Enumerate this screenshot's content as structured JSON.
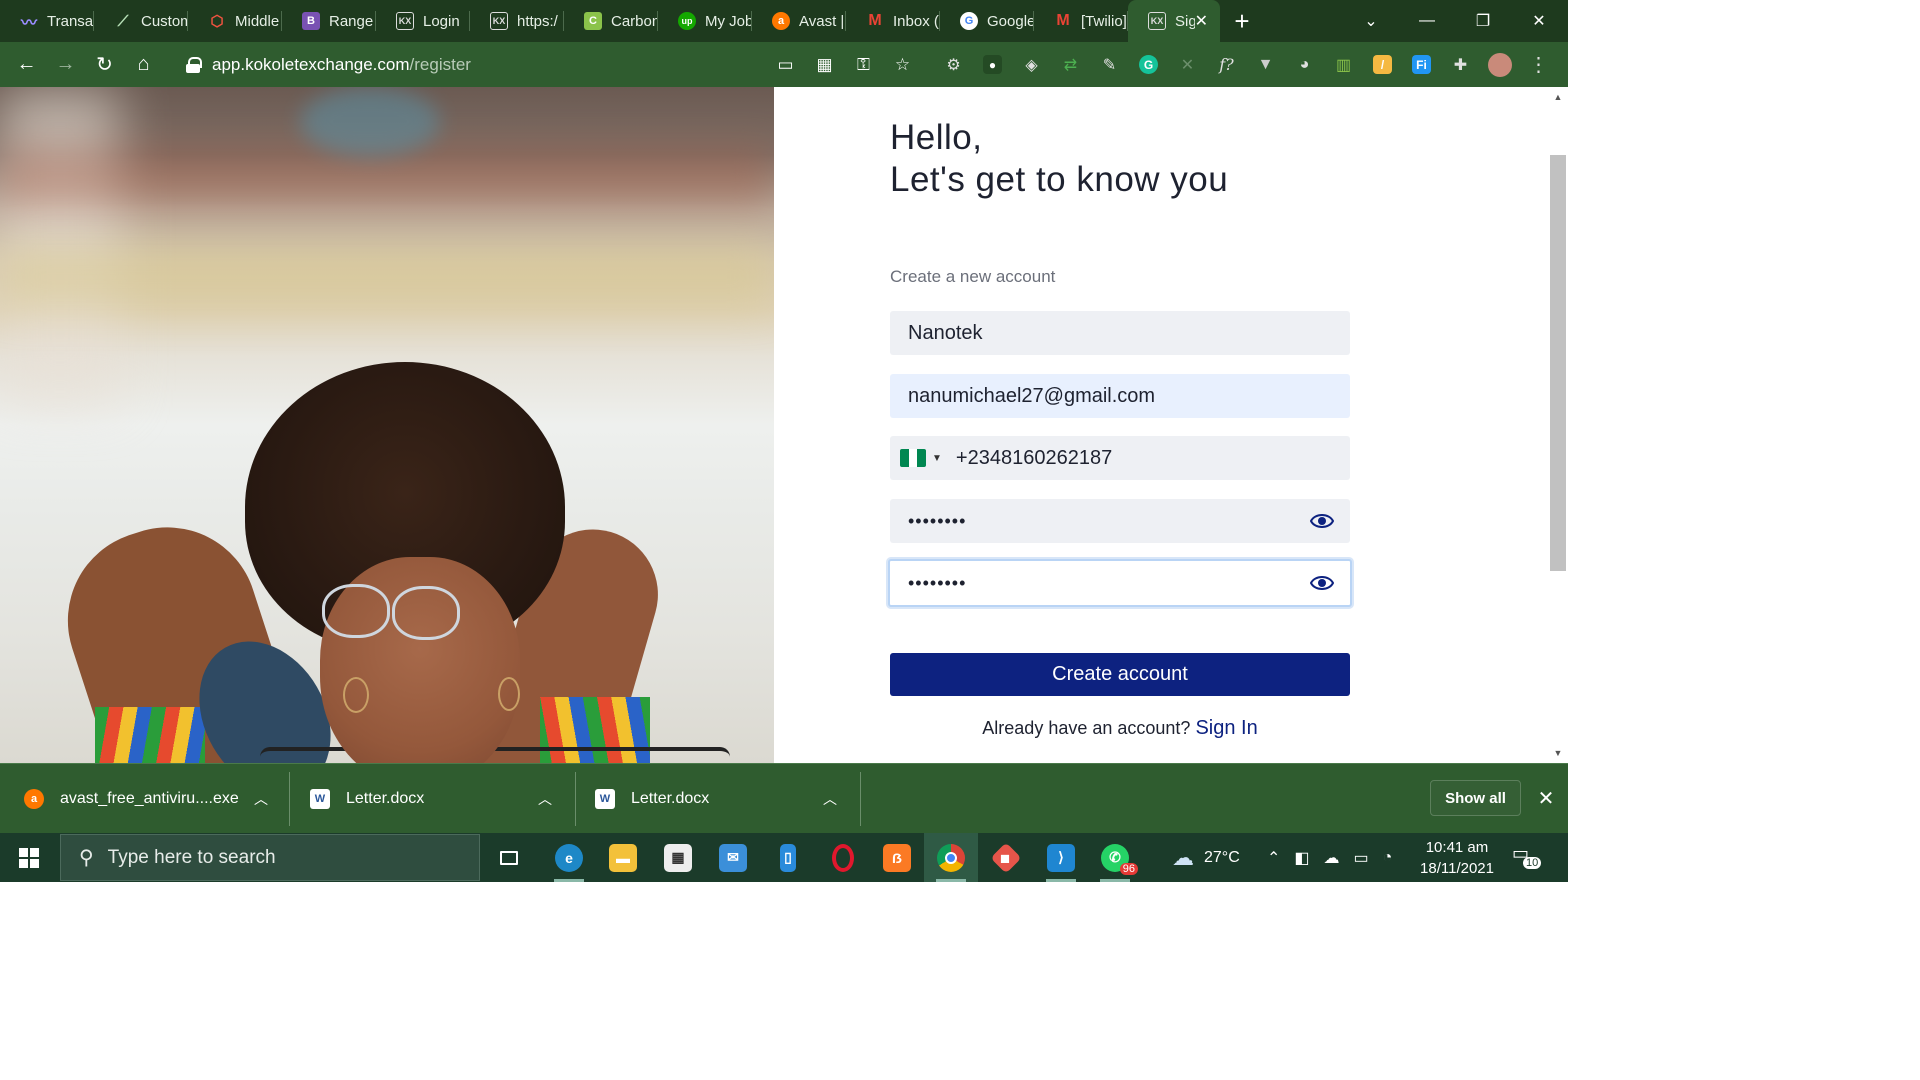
{
  "browser": {
    "tabs": [
      {
        "label": "Transac",
        "icon": "wave-icon",
        "color": "#7b68ee"
      },
      {
        "label": "Custom",
        "icon": "chart-line-icon",
        "color": "#a5d6a7"
      },
      {
        "label": "Middle",
        "icon": "laravel-icon",
        "color": "#f05340"
      },
      {
        "label": "Range",
        "icon": "bootstrap-icon",
        "color": "#7952b3"
      },
      {
        "label": "Login",
        "icon": "kx-icon",
        "color": "#e0e0e0"
      },
      {
        "label": "https:/",
        "icon": "kx-icon",
        "color": "#e0e0e0"
      },
      {
        "label": "Carbon",
        "icon": "carbon-icon",
        "color": "#8bc34a"
      },
      {
        "label": "My Job",
        "icon": "upwork-icon",
        "color": "#14a800"
      },
      {
        "label": "Avast |",
        "icon": "avast-icon",
        "color": "#ff7800"
      },
      {
        "label": "Inbox (",
        "icon": "gmail-icon",
        "color": "#ea4335"
      },
      {
        "label": "Google",
        "icon": "google-icon",
        "color": "#4285f4"
      },
      {
        "label": "[Twilio]",
        "icon": "gmail-icon",
        "color": "#ea4335"
      },
      {
        "label": "Sig",
        "icon": "kx-icon",
        "color": "#e0e0e0",
        "active": true
      }
    ],
    "url_host": "app.kokoletexchange.com",
    "url_path": "/register"
  },
  "page": {
    "greeting_line1": "Hello,",
    "greeting_line2": "Let's get to know you",
    "subtitle": "Create a new account",
    "name_value": "Nanotek",
    "email_value": "nanumichael27@gmail.com",
    "phone_value": "+2348160262187",
    "country_flag": "Nigeria",
    "flag_colors": [
      "#008751",
      "#ffffff",
      "#008751"
    ],
    "password_value": "••••••••",
    "confirm_password_value": "••••••••",
    "create_button": "Create account",
    "have_account_text": "Already have an account?",
    "signin_link": "Sign In",
    "accent_color": "#0d2280"
  },
  "downloads": {
    "items": [
      {
        "name": "avast_free_antiviru....exe",
        "icon": "avast-icon"
      },
      {
        "name": "Letter.docx",
        "icon": "word-icon"
      },
      {
        "name": "Letter.docx",
        "icon": "word-icon"
      }
    ],
    "show_all": "Show all"
  },
  "taskbar": {
    "search_placeholder": "Type here to search",
    "whatsapp_badge": "96",
    "weather": "27°C",
    "time": "10:41 am",
    "date": "18/11/2021",
    "notification_count": "10"
  }
}
